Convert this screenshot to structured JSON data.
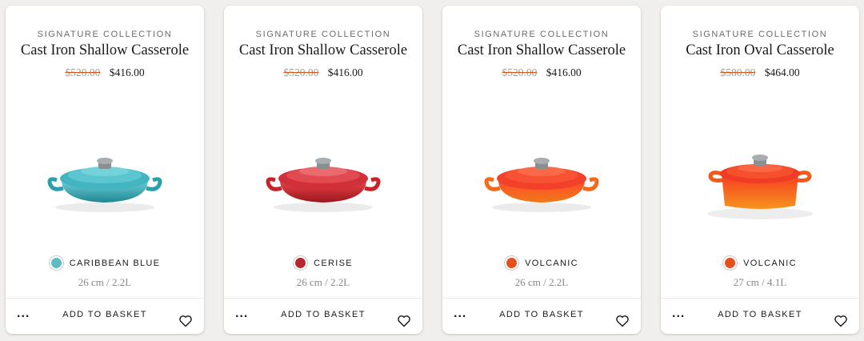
{
  "products": [
    {
      "collection": "SIGNATURE COLLECTION",
      "title": "Cast Iron Shallow Casserole",
      "old_price": "$520.00",
      "new_price": "$416.00",
      "colour": "CARIBBEAN BLUE",
      "swatch_color": "#5bbcc4",
      "body_color": "#2b9fab",
      "size": "26 cm / 2.2L",
      "add_label": "ADD TO BASKET",
      "more_label": "...",
      "image_icon": "shallow-casserole-icon",
      "wishlist_icon": "heart-icon"
    },
    {
      "collection": "SIGNATURE COLLECTION",
      "title": "Cast Iron Shallow Casserole",
      "old_price": "$520.00",
      "new_price": "$416.00",
      "colour": "CERISE",
      "swatch_color": "#b5282e",
      "body_color": "#c8222b",
      "size": "26 cm / 2.2L",
      "add_label": "ADD TO BASKET",
      "more_label": "...",
      "image_icon": "shallow-casserole-icon",
      "wishlist_icon": "heart-icon"
    },
    {
      "collection": "SIGNATURE COLLECTION",
      "title": "Cast Iron Shallow Casserole",
      "old_price": "$520.00",
      "new_price": "$416.00",
      "colour": "VOLCANIC",
      "swatch_color": "#e5501c",
      "body_color": "#f2521a",
      "size": "26 cm / 2.2L",
      "add_label": "ADD TO BASKET",
      "more_label": "...",
      "image_icon": "shallow-casserole-icon",
      "wishlist_icon": "heart-icon"
    },
    {
      "collection": "SIGNATURE COLLECTION",
      "title": "Cast Iron Oval Casserole",
      "old_price": "$580.00",
      "new_price": "$464.00",
      "colour": "VOLCANIC",
      "swatch_color": "#e5501c",
      "body_color": "#f2621a",
      "size": "27 cm / 4.1L",
      "add_label": "ADD TO BASKET",
      "more_label": "...",
      "image_icon": "oval-casserole-icon",
      "wishlist_icon": "heart-icon"
    }
  ]
}
